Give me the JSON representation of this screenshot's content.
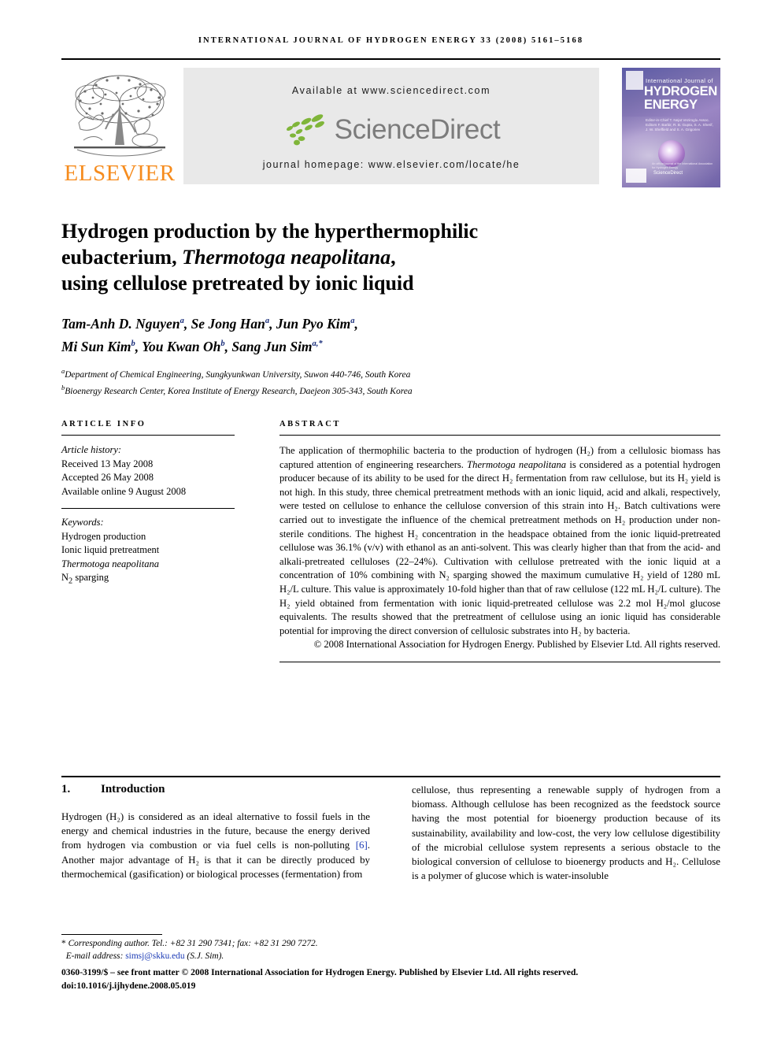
{
  "running_head": "INTERNATIONAL JOURNAL OF HYDROGEN ENERGY 33 (2008) 5161–5168",
  "masthead": {
    "publisher_name": "ELSEVIER",
    "available_at": "Available at www.sciencedirect.com",
    "sciencedirect_wordmark": "ScienceDirect",
    "journal_homepage": "journal homepage: www.elsevier.com/locate/he",
    "cover": {
      "line1": "International Journal of",
      "line2": "HYDROGEN",
      "line3": "ENERGY",
      "editors": "Editor-in-Chief   T. Nejat Veziroglu\nAssoc. Editors   F. Barbir, R. B. Gupta,\nS. A. Sherif, J. W. Sheffield\nand S. A. Grigoriev",
      "sciencedirect": "ScienceDirect",
      "note": "An official journal of the International Association for Hydrogen Energy"
    }
  },
  "article": {
    "title_line1": "Hydrogen production by the hyperthermophilic",
    "title_line2_pre": "eubacterium, ",
    "title_line2_italic": "Thermotoga neapolitana",
    "title_line2_post": ",",
    "title_line3": "using cellulose pretreated by ionic liquid",
    "authors_line1": "Tam-Anh D. Nguyen",
    "authors": [
      {
        "name": "Tam-Anh D. Nguyen",
        "sup": "a"
      },
      {
        "name": "Se Jong Han",
        "sup": "a"
      },
      {
        "name": "Jun Pyo Kim",
        "sup": "a"
      },
      {
        "name": "Mi Sun Kim",
        "sup": "b"
      },
      {
        "name": "You Kwan Oh",
        "sup": "b"
      },
      {
        "name": "Sang Jun Sim",
        "sup": "a,*"
      }
    ],
    "affiliations": [
      {
        "marker": "a",
        "text": "Department of Chemical Engineering, Sungkyunkwan University, Suwon 440-746, South Korea"
      },
      {
        "marker": "b",
        "text": "Bioenergy Research Center, Korea Institute of Energy Research, Daejeon 305-343, South Korea"
      }
    ]
  },
  "article_info": {
    "label": "ARTICLE INFO",
    "history_heading": "Article history:",
    "history": [
      "Received 13 May 2008",
      "Accepted 26 May 2008",
      "Available online 9 August 2008"
    ],
    "keywords_heading": "Keywords:",
    "keywords": [
      "Hydrogen production",
      "Ionic liquid pretreatment",
      "Thermotoga neapolitana",
      "N2 sparging"
    ]
  },
  "abstract": {
    "label": "ABSTRACT",
    "paragraph_1": "The application of thermophilic bacteria to the production of hydrogen (H₂) from a cellulosic biomass has captured attention of engineering researchers. ",
    "organism": "Thermotoga neapolitana",
    "paragraph_2": " is considered as a potential hydrogen producer because of its ability to be used for the direct H₂ fermentation from raw cellulose, but its H₂ yield is not high. In this study, three chemical pretreatment methods with an ionic liquid, acid and alkali, respectively, were tested on cellulose to enhance the cellulose conversion of this strain into H₂. Batch cultivations were carried out to investigate the influence of the chemical pretreatment methods on H₂ production under non-sterile conditions. The highest H₂ concentration in the headspace obtained from the ionic liquid-pretreated cellulose was 36.1% (v/v) with ethanol as an anti-solvent. This was clearly higher than that from the acid- and alkali-pretreated celluloses (22–24%). Cultivation with cellulose pretreated with the ionic liquid at a concentration of 10% combining with N₂ sparging showed the maximum cumulative H₂ yield of 1280 mL H₂/L culture. This value is approximately 10-fold higher than that of raw cellulose (122 mL H₂/L culture). The H₂ yield obtained from fermentation with ionic liquid-pretreated cellulose was 2.2 mol H₂/mol glucose equivalents. The results showed that the pretreatment of cellulose using an ionic liquid has considerable potential for improving the direct conversion of cellulosic substrates into H₂ by bacteria.",
    "copyright": "© 2008 International Association for Hydrogen Energy. Published by Elsevier Ltd. All rights reserved."
  },
  "introduction": {
    "number": "1.",
    "heading": "Introduction",
    "left_text_a": "Hydrogen (H₂) is considered as an ideal alternative to fossil fuels in the energy and chemical industries in the future, because the energy derived from hydrogen via combustion or via fuel cells is non-polluting ",
    "citation": "[6]",
    "left_text_b": ". Another major advantage of H₂ is that it can be directly produced by thermochemical (gasification) or biological processes (fermentation) from",
    "right_text": "cellulose, thus representing a renewable supply of hydrogen from a biomass. Although cellulose has been recognized as the feedstock source having the most potential for bioenergy production because of its sustainability, availability and low-cost, the very low cellulose digestibility of the microbial cellulose system represents a serious obstacle to the biological conversion of cellulose to bioenergy products and H₂. Cellulose is a polymer of glucose which is water-insoluble"
  },
  "footer": {
    "corresponding_star": "*",
    "corresponding": "Corresponding author. Tel.: +82 31 290 7341; fax: +82 31 290 7272.",
    "email_label": "E-mail address: ",
    "email": "simsj@skku.edu",
    "email_suffix": " (S.J. Sim).",
    "imprint_line1": "0360-3199/$ – see front matter © 2008 International Association for Hydrogen Energy. Published by Elsevier Ltd. All rights reserved.",
    "imprint_line2": "doi:10.1016/j.ijhydene.2008.05.019"
  }
}
